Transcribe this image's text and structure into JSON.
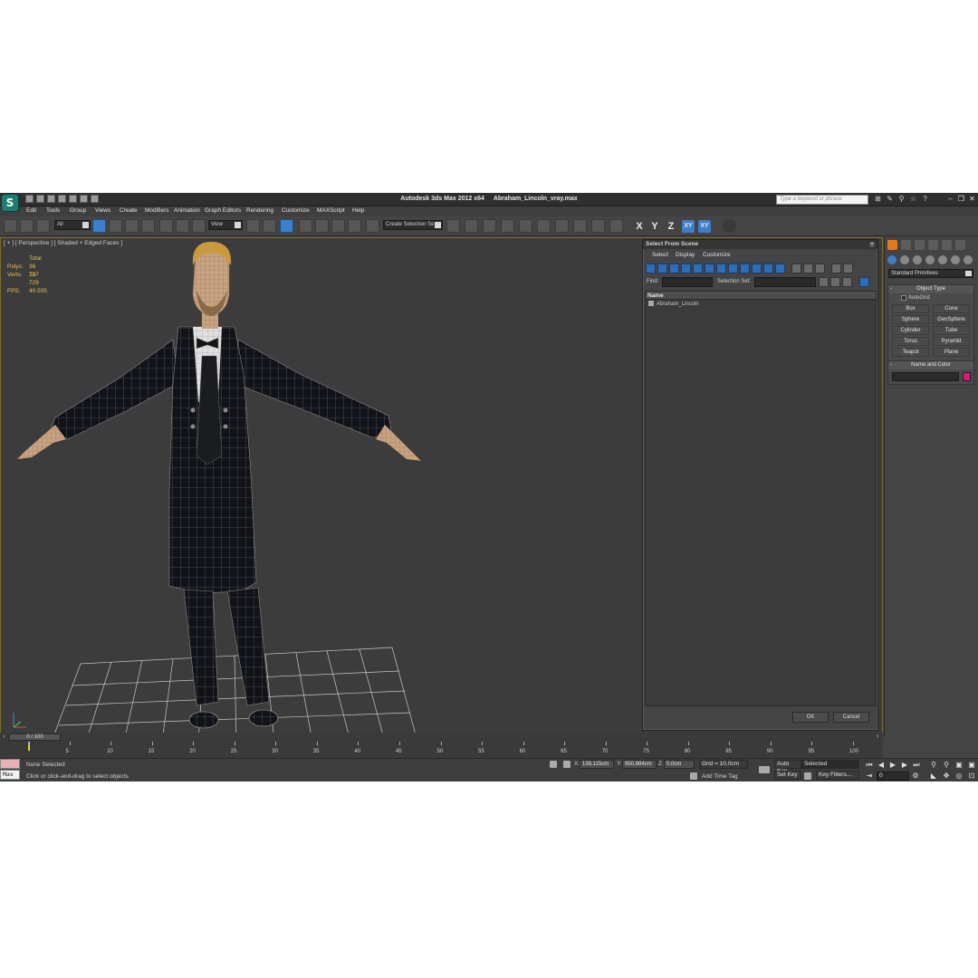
{
  "app": {
    "logo_text": "S",
    "title": "Autodesk 3ds Max  2012 x64",
    "filename": "Abraham_Lincoln_vray.max",
    "search_placeholder": "Type a keyword or phrase"
  },
  "menu": [
    "Edit",
    "Tools",
    "Group",
    "Views",
    "Create",
    "Modifiers",
    "Animation",
    "Graph Editors",
    "Rendering",
    "Customize",
    "MAXScript",
    "Help"
  ],
  "toolbar": {
    "filter_value": "All",
    "refcoord_value": "View",
    "selection_set_placeholder": "Create Selection Se",
    "axis_x": "X",
    "axis_y": "Y",
    "axis_z": "Z",
    "axis_xy": "XY",
    "axis_xy2": "XY"
  },
  "viewport": {
    "label": "[ + ] [ Perspective ] [ Shaded + Edged Faces ]",
    "stats_header": "Total",
    "polys_label": "Polys:",
    "polys_value": "36 727",
    "verts_label": "Verts:",
    "verts_value": "19 729",
    "fps_label": "FPS:",
    "fps_value": "40.505"
  },
  "dialog": {
    "title": "Select From Scene",
    "menu": [
      "Select",
      "Display",
      "Customize"
    ],
    "find_label": "Find:",
    "selection_set_label": "Selection Set:",
    "list_header": "Name",
    "items": [
      "Abraham_Lincoln"
    ],
    "ok_label": "OK",
    "cancel_label": "Cancel"
  },
  "command_panel": {
    "category": "Standard Primitives",
    "object_type_title": "Object Type",
    "autogrid_label": "AutoGrid",
    "object_buttons": [
      "Box",
      "Cone",
      "Sphere",
      "GeoSphere",
      "Cylinder",
      "Tube",
      "Torus",
      "Pyramid",
      "Teapot",
      "Plane"
    ],
    "name_color_title": "Name and Color",
    "swatch_color": "#e0157a"
  },
  "timeline": {
    "frame_display": "0 / 100",
    "ticks": [
      "0",
      "5",
      "10",
      "15",
      "20",
      "25",
      "30",
      "35",
      "40",
      "45",
      "50",
      "55",
      "60",
      "65",
      "70",
      "75",
      "80",
      "85",
      "90",
      "95",
      "100"
    ]
  },
  "status": {
    "max_script_label": "Max",
    "selection_status": "None Selected",
    "prompt": "Click or click-and-drag to select objects",
    "x_label": "X:",
    "x_value": "139,115cm",
    "y_label": "Y:",
    "y_value": "950,984cm",
    "z_label": "Z:",
    "z_value": "0,0cm",
    "grid": "Grid = 10,0cm",
    "add_time_tag": "Add Time Tag",
    "auto_key": "Auto Key",
    "set_key": "Set Key",
    "key_mode_value": "Selected",
    "key_filters": "Key Filters...",
    "current_frame": "0"
  }
}
